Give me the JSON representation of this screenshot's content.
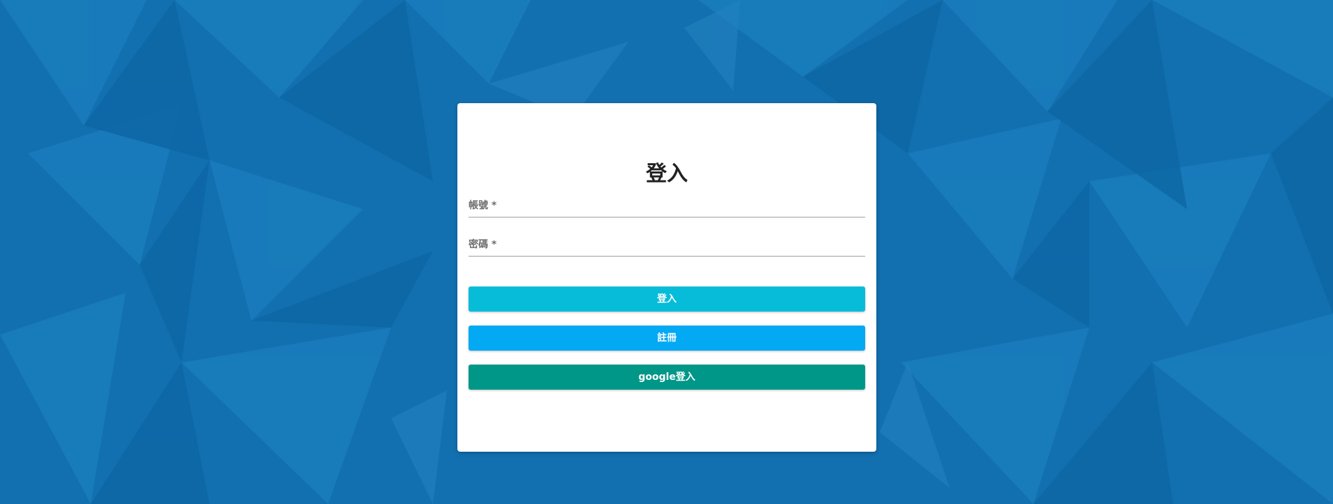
{
  "login_form": {
    "title": "登入",
    "account_label": "帳號 *",
    "account_value": "",
    "password_label": "密碼 *",
    "password_value": "",
    "login_button": "登入",
    "register_button": "註冊",
    "google_button": "google登入"
  },
  "colors": {
    "background": "#1270b0",
    "login_button": "#06bcd9",
    "register_button": "#04a9f4",
    "google_button": "#009788"
  }
}
